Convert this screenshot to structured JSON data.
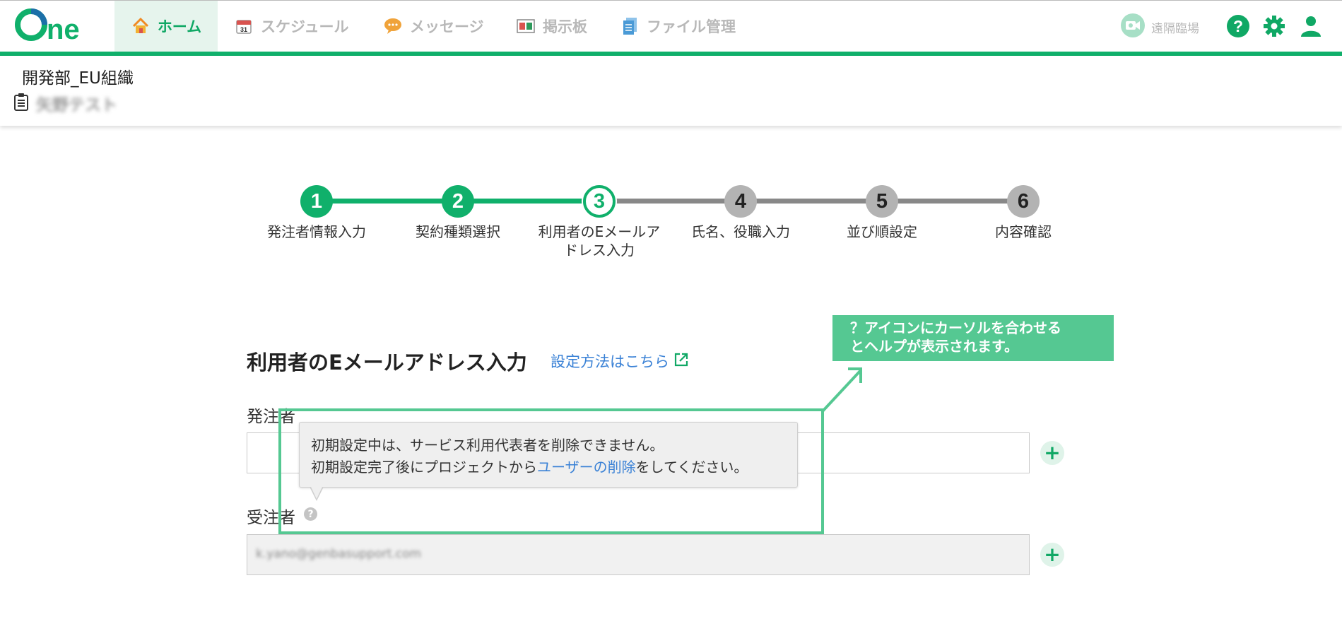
{
  "nav": {
    "logo_text": "One",
    "tabs": [
      {
        "label": "ホーム",
        "icon": "home-icon",
        "active": true
      },
      {
        "label": "スケジュール",
        "icon": "calendar-icon",
        "active": false
      },
      {
        "label": "メッセージ",
        "icon": "chat-bubble-icon",
        "active": false
      },
      {
        "label": "掲示板",
        "icon": "bulletin-board-icon",
        "active": false
      },
      {
        "label": "ファイル管理",
        "icon": "files-icon",
        "active": false
      }
    ],
    "remote_label": "遠隔臨場",
    "tools": [
      "help-icon",
      "gear-icon",
      "user-icon"
    ],
    "accent_color": "#10b06b"
  },
  "subheader": {
    "org_name": "開発部_EU組織",
    "project_name": "矢野テスト"
  },
  "stepper": {
    "steps": [
      {
        "number": "1",
        "label_lines": [
          "発注者情報入力"
        ],
        "state": "done"
      },
      {
        "number": "2",
        "label_lines": [
          "契約種類選択"
        ],
        "state": "done"
      },
      {
        "number": "3",
        "label_lines": [
          "利用者のEメールア",
          "ドレス入力"
        ],
        "state": "current"
      },
      {
        "number": "4",
        "label_lines": [
          "氏名、役職入力"
        ],
        "state": "todo"
      },
      {
        "number": "5",
        "label_lines": [
          "並び順設定"
        ],
        "state": "todo"
      },
      {
        "number": "6",
        "label_lines": [
          "内容確認"
        ],
        "state": "todo"
      }
    ]
  },
  "form": {
    "title": "利用者のEメールアドレス入力",
    "help_link": "設定方法はこちら",
    "orderer_label": "発注者",
    "orderer_value": "",
    "contractor_label": "受注者",
    "contractor_value": "k.yano@genbasupport.com",
    "add_symbol": "+",
    "help_mark": "?"
  },
  "tooltip": {
    "line1": "初期設定中は、サービス利用代表者を削除できません。",
    "line2_prefix": "初期設定完了後にプロジェクトから",
    "line2_link": "ユーザーの削除",
    "line2_suffix": "をしてください。"
  },
  "annotation": {
    "line1": "？アイコンにカーソルを合わせる",
    "line2": "とヘルプが表示されます。"
  }
}
